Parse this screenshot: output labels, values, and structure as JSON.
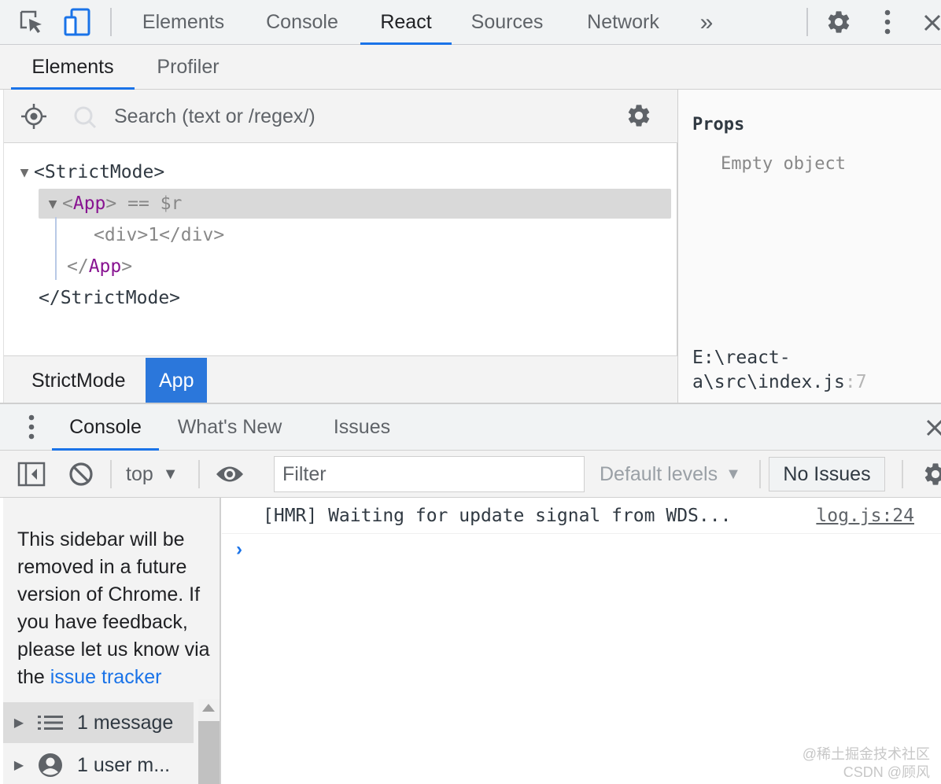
{
  "topbar": {
    "tabs": [
      {
        "label": "Elements"
      },
      {
        "label": "Console"
      },
      {
        "label": "React"
      },
      {
        "label": "Sources"
      },
      {
        "label": "Network"
      }
    ],
    "active_tab": "React",
    "more_label": "»"
  },
  "react_tabs": {
    "tabs": [
      {
        "label": "Elements"
      },
      {
        "label": "Profiler"
      }
    ],
    "active_tab": "Elements"
  },
  "search": {
    "placeholder": "Search (text or /regex/)"
  },
  "tree": {
    "rows": [
      {
        "open": "<StrictMode>"
      },
      {
        "open_lt": "<",
        "name": "App",
        "open_gt": ">",
        "suffix": " == $r"
      },
      {
        "text": "<div>1</div>"
      },
      {
        "close_lt": "</",
        "name": "App",
        "close_gt": ">"
      },
      {
        "close": "</StrictMode>"
      }
    ],
    "toggle_symbol": "▼"
  },
  "breadcrumbs": [
    {
      "label": "StrictMode"
    },
    {
      "label": "App"
    }
  ],
  "props": {
    "title": "Props",
    "empty": "Empty object",
    "source_line1": "E:\\react-",
    "source_line2": "a\\src\\index.js",
    "source_line_no": ":7"
  },
  "drawer": {
    "tabs": [
      {
        "label": "Console"
      },
      {
        "label": "What's New"
      },
      {
        "label": "Issues"
      }
    ],
    "active_tab": "Console"
  },
  "console_toolbar": {
    "context": "top",
    "filter_placeholder": "Filter",
    "levels": "Default levels",
    "issues_button": "No Issues"
  },
  "sidebar": {
    "note": "This sidebar will be removed in a future version of Chrome. If you have feedback, please let us know via the",
    "link": "issue tracker",
    "items": [
      {
        "label": "1 message"
      },
      {
        "label": "1 user m..."
      }
    ]
  },
  "console": {
    "log_text": "[HMR] Waiting for update signal from WDS...",
    "log_source": "log.js:24",
    "prompt": "›"
  },
  "watermark": {
    "line1": "@稀土掘金技术社区",
    "line2": "CSDN @顾风"
  },
  "colors": {
    "accent": "#1a73e8",
    "breadcrumb_active": "#2b77db",
    "component_name": "#881391"
  }
}
